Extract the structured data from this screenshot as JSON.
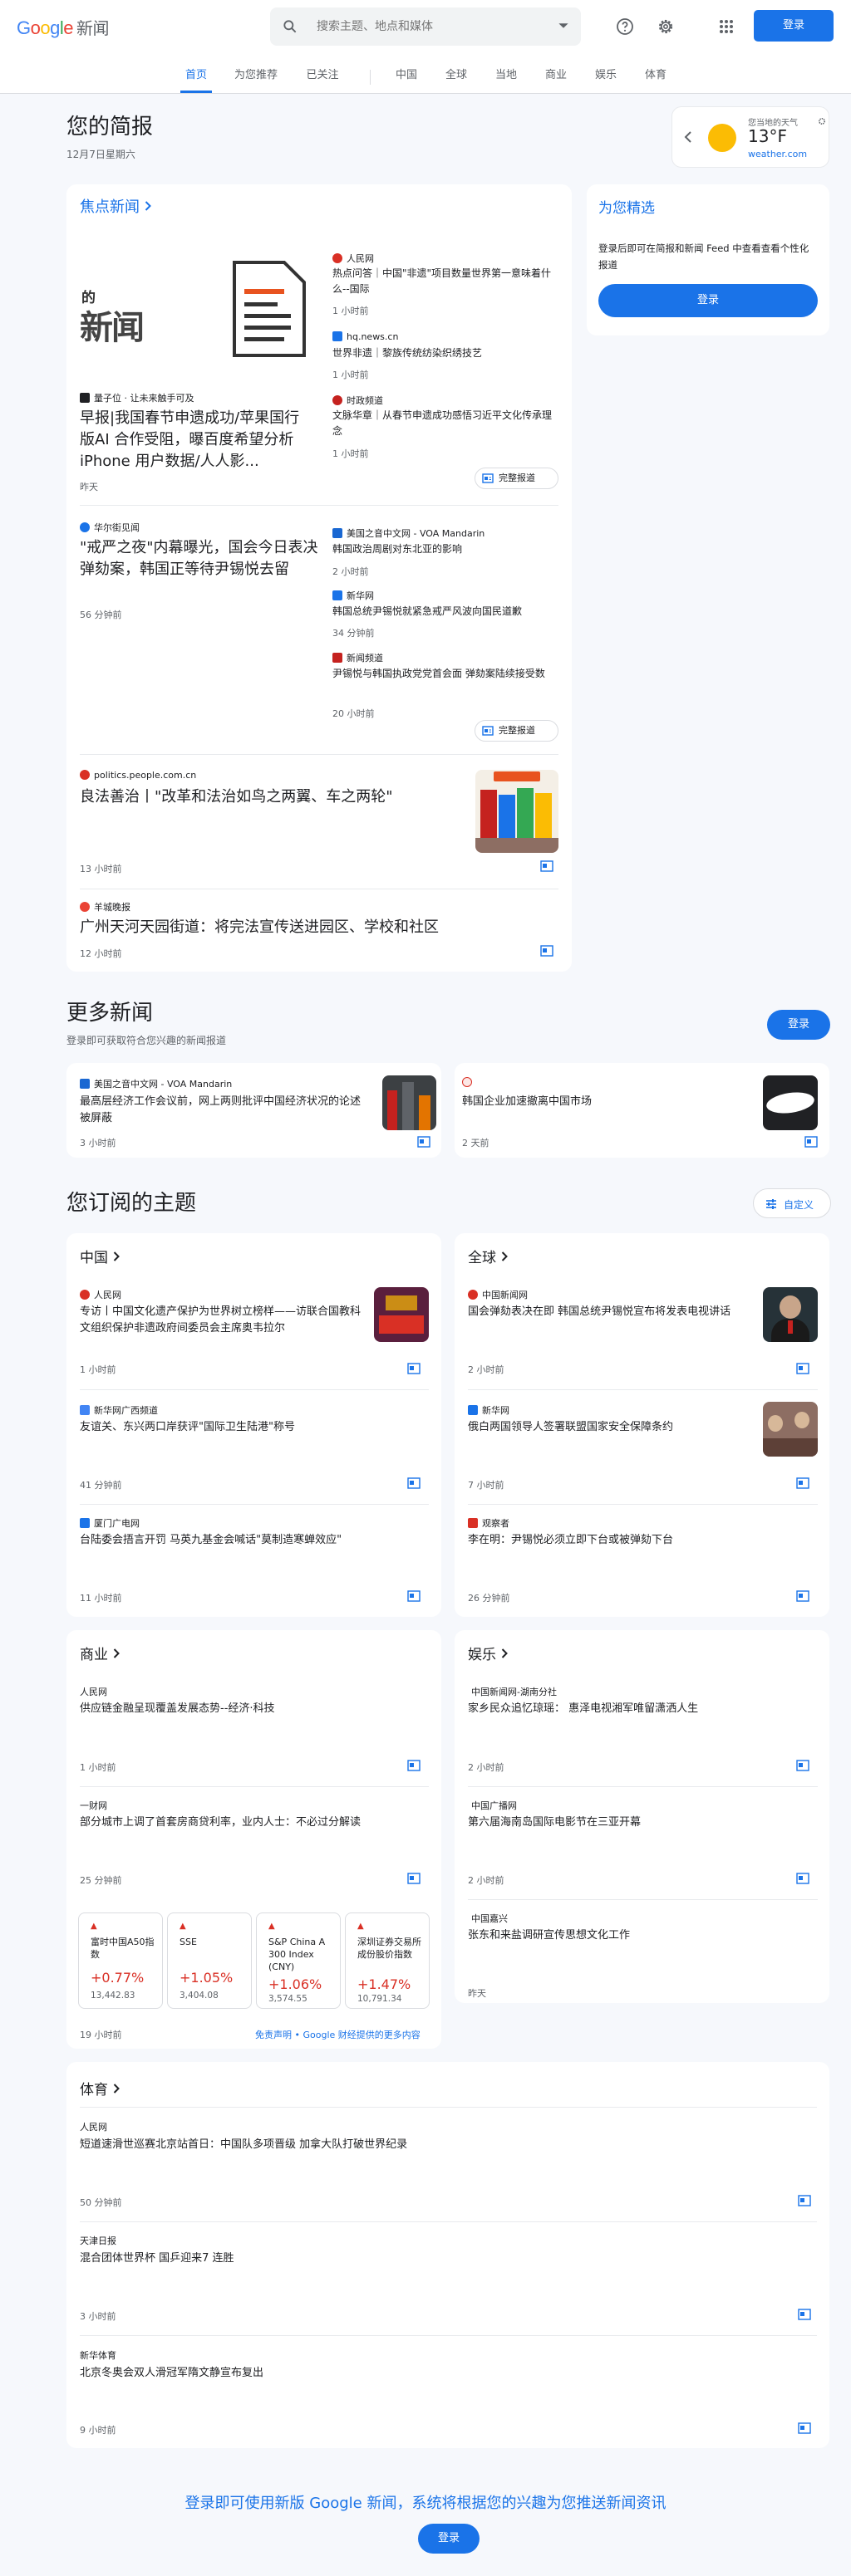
{
  "header": {
    "logo": {
      "g": "G",
      "o1": "o",
      "o2": "o",
      "g2": "g",
      "l": "l",
      "e": "e",
      "suffix": "新闻"
    },
    "search_placeholder": "搜索主题、地点和媒体",
    "signin_label": "登录"
  },
  "tabs": [
    {
      "label": "首页",
      "active": true
    },
    {
      "label": "为您推荐"
    },
    {
      "label": "已关注"
    },
    {
      "label": "中国"
    },
    {
      "label": "全球"
    },
    {
      "label": "当地"
    },
    {
      "label": "商业"
    },
    {
      "label": "娱乐"
    },
    {
      "label": "体育"
    }
  ],
  "briefing": {
    "title": "您的简报",
    "date": "12月7日星期六"
  },
  "weather": {
    "location": "您当地的天气",
    "temp": "13°F",
    "source": "weather.com"
  },
  "top_stories": {
    "heading": "焦点新闻",
    "full_coverage_label": "完整报道",
    "cluster1": {
      "image_text": "的 新闻",
      "main": {
        "source": "量子位 · 让未来触手可及",
        "title": "早报|我国春节申遗成功/苹果国行版AI 合作受阻，曝百度希望分析iPhone 用户数据/人人影...",
        "time": "昨天"
      },
      "side": [
        {
          "source": "人民网",
          "title": "热点问答｜中国\"非遗\"项目数量世界第一意味着什么--国际",
          "time": "1 小时前"
        },
        {
          "source": "hq.news.cn",
          "title": "世界非遗｜黎族传统纺染织绣技艺",
          "time": "1 小时前"
        },
        {
          "source": "时政频道",
          "title": "文脉华章｜从春节申遗成功感悟习近平文化传承理念",
          "time": "1 小时前"
        }
      ]
    },
    "cluster2": {
      "main": {
        "source": "华尔街见闻",
        "title": "\"戒严之夜\"内幕曝光，国会今日表决弹劾案，韩国正等待尹锡悦去留",
        "time": "56 分钟前"
      },
      "side": [
        {
          "source": "美国之音中文网 - VOA Mandarin",
          "title": "韩国政治周剧对东北亚的影响",
          "time": "2 小时前"
        },
        {
          "source": "新华网",
          "title": "韩国总统尹锡悦就紧急戒严风波向国民道歉",
          "time": "34 分钟前"
        },
        {
          "source": "新闻频道",
          "title": "尹锡悦与韩国执政党党首会面 弹劾案陆续接受数",
          "time": "20 小时前"
        }
      ]
    },
    "story3": {
      "source": "politics.people.com.cn",
      "title": "良法善治丨\"改革和法治如鸟之两翼、车之两轮\"",
      "time": "13 小时前"
    },
    "story4": {
      "source": "羊城晚报",
      "title": "广州天河天园街道：将完法宣传送进园区、学校和社区",
      "time": "12 小时前"
    }
  },
  "picks": {
    "heading": "为您精选",
    "text": "登录后即可在简报和新闻 Feed 中查看查看个性化报道",
    "button": "登录"
  },
  "more_news": {
    "title": "更多新闻",
    "subtitle": "登录即可获取符合您兴趣的新闻报道",
    "button": "登录",
    "items": [
      {
        "source": "美国之音中文网 - VOA Mandarin",
        "title": "最高层经济工作会议前，网上两则批评中国经济状况的论述被屏蔽",
        "time": "3 小时前"
      },
      {
        "source": "",
        "title": "韩国企业加速撤离中国市场",
        "time": "2 天前"
      }
    ]
  },
  "topics": {
    "title": "您订阅的主题",
    "customize": "自定义"
  },
  "china": {
    "heading": "中国",
    "items": [
      {
        "source": "人民网",
        "title": "专访丨中国文化遗产保护为世界树立榜样——访联合国教科文组织保护非遗政府间委员会主席奥韦拉尔",
        "time": "1 小时前"
      },
      {
        "source": "新华网广西频道",
        "title": "友谊关、东兴两口岸获评\"国际卫生陆港\"称号",
        "time": "41 分钟前"
      },
      {
        "source": "厦门广电网",
        "title": "台陆委会捂言开罚 马英九基金会喊话\"莫制造寒蝉效应\"",
        "time": "11 小时前"
      }
    ]
  },
  "world": {
    "heading": "全球",
    "items": [
      {
        "source": "中国新闻网",
        "title": "国会弹劾表决在即 韩国总统尹锡悦宣布将发表电视讲话",
        "time": "2 小时前"
      },
      {
        "source": "新华网",
        "title": "俄白两国领导人签署联盟国家安全保障条约",
        "time": "7 小时前"
      },
      {
        "source": "观察者",
        "title": "李在明：尹锡悦必须立即下台或被弹劾下台",
        "time": "26 分钟前"
      }
    ]
  },
  "business": {
    "heading": "商业",
    "items": [
      {
        "source": "人民网",
        "title": "供应链金融呈现覆盖发展态势--经济·科技",
        "time": "1 小时前"
      },
      {
        "source": "一财网",
        "title": "部分城市上调了首套房商贷利率，业内人士：不必过分解读",
        "time": "25 分钟前"
      }
    ],
    "stocks": [
      {
        "arrow": "▲",
        "name": "富时中国A50指数",
        "change": "+0.77%",
        "value": "13,442.83"
      },
      {
        "arrow": "▲",
        "name": "SSE",
        "change": "+1.05%",
        "value": "3,404.08"
      },
      {
        "arrow": "▲",
        "name": "S&P China A 300 Index (CNY)",
        "change": "+1.06%",
        "value": "3,574.55"
      },
      {
        "arrow": "▲",
        "name": "深圳证券交易所成份股价指数",
        "change": "+1.47%",
        "value": "10,791.34"
      }
    ],
    "stocks_time": "19 小时前",
    "disclaimer": "免责声明 • Google 财经提供的更多内容"
  },
  "entertainment": {
    "heading": "娱乐",
    "items": [
      {
        "source": "中国新闻网-湖南分社",
        "title": "家乡民众追忆琼瑶： 惠泽电视湘军唯留潇洒人生",
        "time": "2 小时前"
      },
      {
        "source": "中国广播网",
        "title": "第六届海南岛国际电影节在三亚开幕",
        "time": "2 小时前"
      },
      {
        "source": "中国嘉兴",
        "title": "张东和来盐调研宣传思想文化工作",
        "time": "昨天"
      }
    ]
  },
  "sports": {
    "heading": "体育",
    "items": [
      {
        "source": "人民网",
        "title": "短道速滑世巡赛北京站首日：中国队多项晋级 加拿大队打破世界纪录",
        "time": "50 分钟前"
      },
      {
        "source": "天津日报",
        "title": "混合团体世界杯 国乒迎来7 连胜",
        "time": "3 小时前"
      },
      {
        "source": "新华体育",
        "title": "北京冬奥会双人滑冠军隋文静宣布复出",
        "time": "9 小时前"
      }
    ]
  },
  "footer": {
    "text": "登录即可使用新版 Google 新闻，系统将根据您的兴趣为您推送新闻资讯",
    "button": "登录"
  },
  "colors": {
    "accent": "#1a73e8",
    "negative": "#d93025",
    "background": "#f6f8fc"
  }
}
